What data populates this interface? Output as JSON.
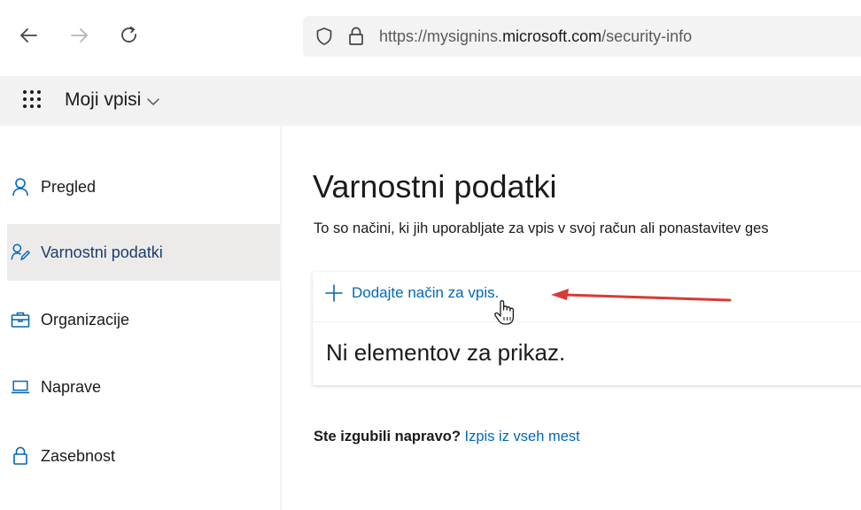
{
  "browser": {
    "url_prefix": "https://mysignins.",
    "url_domain": "microsoft.com",
    "url_path": "/security-info",
    "icons": [
      "back-icon",
      "forward-icon",
      "reload-icon",
      "shield-icon",
      "lock-icon"
    ]
  },
  "header": {
    "app_title": "Moji vpisi",
    "icons": [
      "app-launcher-icon",
      "chevron-down-icon"
    ]
  },
  "sidebar": {
    "items": [
      {
        "label": "Pregled",
        "icon": "person-icon",
        "active": false
      },
      {
        "label": "Varnostni podatki",
        "icon": "security-info-icon",
        "active": true
      },
      {
        "label": "Organizacije",
        "icon": "briefcase-icon",
        "active": false
      },
      {
        "label": "Naprave",
        "icon": "laptop-icon",
        "active": false
      },
      {
        "label": "Zasebnost",
        "icon": "lock-icon",
        "active": false
      }
    ]
  },
  "main": {
    "title": "Varnostni podatki",
    "description": "To so načini, ki jih uporabljate za vpis v svoj račun ali ponastavitev ges",
    "add_method_label": "Dodajte način za vpis.",
    "empty_message": "Ni elementov za prikaz.",
    "lost_device_question": "Ste izgubili napravo?",
    "sign_out_everywhere_label": "Izpis iz vseh mest"
  },
  "colors": {
    "link": "#0067b8",
    "active_nav_bg": "#edebe9",
    "header_bg": "#f2f2f2",
    "annotation_arrow": "#d83b34"
  }
}
